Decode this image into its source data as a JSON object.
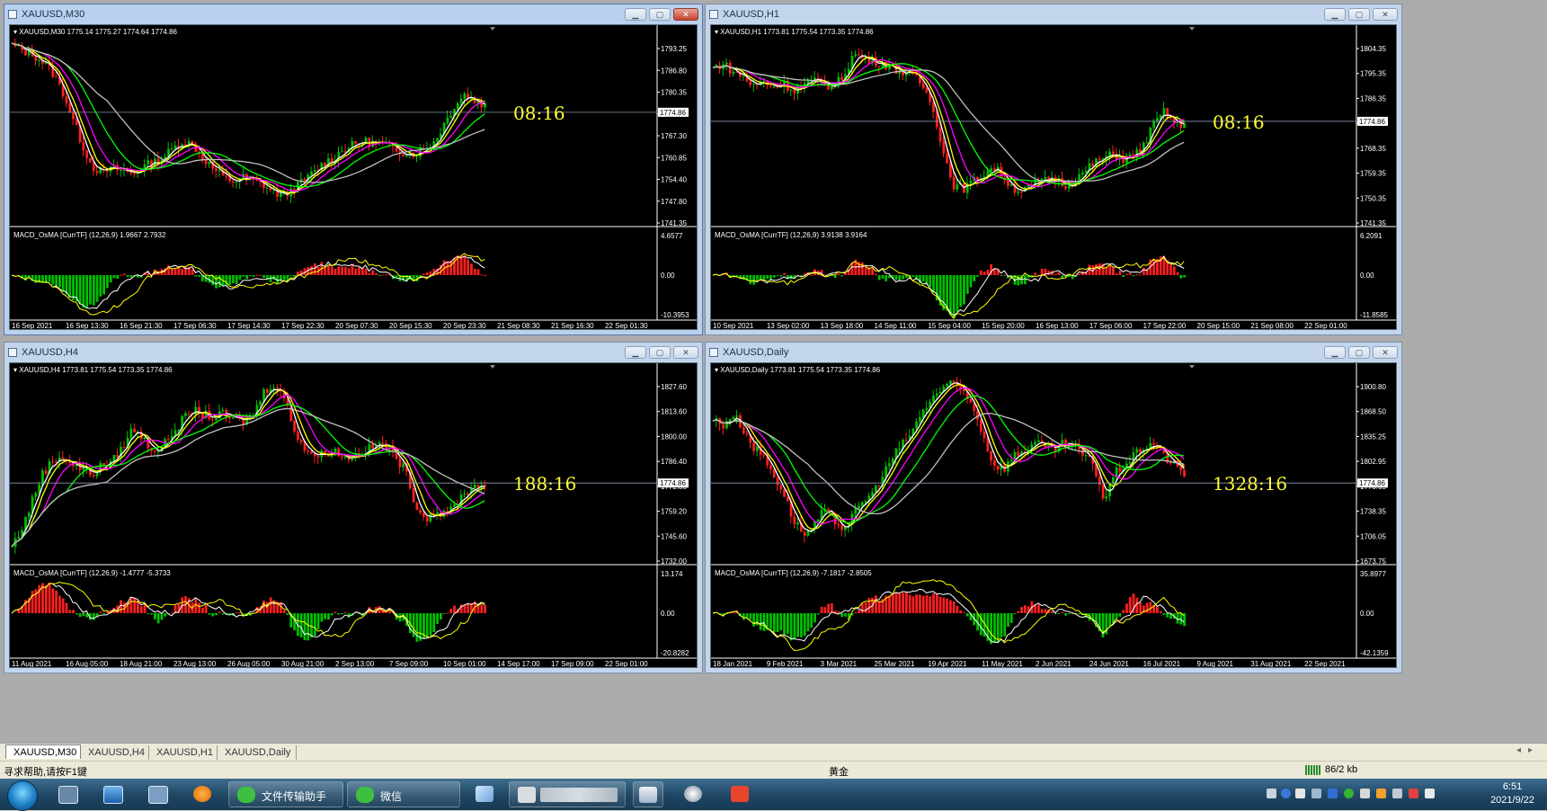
{
  "charts": [
    {
      "title": "XAUUSD,M30",
      "info": "XAUUSD,M30  1775.14 1775.27 1774.64 1774.86",
      "price_labels": [
        "1793.25",
        "1786.80",
        "1780.35",
        "1773.90",
        "1767.30",
        "1760.85",
        "1754.40",
        "1747.80",
        "1741.35"
      ],
      "current_price": "1774.86",
      "current_level": 0.42,
      "timer": "08:16",
      "ind_info": "MACD_OsMA [CurrTF] (12,26,9) 1.9667 2.7932",
      "ind_labels": [
        "4.6577",
        "0.00",
        "-10.3953"
      ],
      "time_labels": [
        "16 Sep 2021",
        "16 Sep 13:30",
        "16 Sep 21:30",
        "17 Sep 06:30",
        "17 Sep 14:30",
        "17 Sep 22:30",
        "20 Sep 07:30",
        "20 Sep 15:30",
        "20 Sep 23:30",
        "21 Sep 08:30",
        "21 Sep 16:30",
        "22 Sep 01:30"
      ],
      "active": true,
      "series": [
        0.95,
        0.92,
        0.9,
        0.86,
        0.8,
        0.7,
        0.55,
        0.4,
        0.28,
        0.25,
        0.27,
        0.26,
        0.24,
        0.28,
        0.3,
        0.33,
        0.38,
        0.42,
        0.4,
        0.33,
        0.27,
        0.22,
        0.2,
        0.22,
        0.2,
        0.18,
        0.14,
        0.12,
        0.16,
        0.2,
        0.25,
        0.3,
        0.33,
        0.38,
        0.4,
        0.42,
        0.41,
        0.4,
        0.38,
        0.36,
        0.35,
        0.38,
        0.42,
        0.52,
        0.62,
        0.68,
        0.64,
        0.62
      ]
    },
    {
      "title": "XAUUSD,H1",
      "info": "XAUUSD,H1  1773.81 1775.54 1773.35 1774.86",
      "price_labels": [
        "1804.35",
        "1795.35",
        "1786.35",
        "1777.35",
        "1768.35",
        "1759.35",
        "1750.35",
        "1741.35"
      ],
      "current_price": "1774.86",
      "current_level": 0.47,
      "timer": "08:16",
      "ind_info": "MACD_OsMA [CurrTF] (12,26,9) 3.9138 3.9164",
      "ind_labels": [
        "6.2091",
        "0.00",
        "-11.8585"
      ],
      "time_labels": [
        "10 Sep 2021",
        "13 Sep 02:00",
        "13 Sep 18:00",
        "14 Sep 11:00",
        "15 Sep 04:00",
        "15 Sep 20:00",
        "16 Sep 13:00",
        "17 Sep 06:00",
        "17 Sep 22:00",
        "20 Sep 15:00",
        "21 Sep 08:00",
        "22 Sep 01:00"
      ],
      "active": false,
      "series": [
        0.82,
        0.85,
        0.8,
        0.78,
        0.72,
        0.75,
        0.72,
        0.74,
        0.7,
        0.73,
        0.75,
        0.74,
        0.72,
        0.78,
        0.9,
        0.88,
        0.86,
        0.85,
        0.82,
        0.8,
        0.78,
        0.72,
        0.6,
        0.35,
        0.18,
        0.16,
        0.2,
        0.24,
        0.28,
        0.22,
        0.16,
        0.15,
        0.18,
        0.2,
        0.22,
        0.18,
        0.2,
        0.25,
        0.3,
        0.33,
        0.35,
        0.32,
        0.34,
        0.4,
        0.52,
        0.58,
        0.52,
        0.5
      ]
    },
    {
      "title": "XAUUSD,H4",
      "info": "XAUUSD,H4  1773.81 1775.54 1773.35 1774.86",
      "price_labels": [
        "1827.60",
        "1813.60",
        "1800.00",
        "1786.40",
        "1772.80",
        "1759.20",
        "1745.60",
        "1732.00"
      ],
      "current_price": "1774.86",
      "current_level": 0.6,
      "timer": "188:16",
      "ind_info": "MACD_OsMA [CurrTF] (12,26,9) -1.4777 -5.3733",
      "ind_labels": [
        "13.174",
        "0.00",
        "-20.8282"
      ],
      "time_labels": [
        "11 Aug 2021",
        "16 Aug 05:00",
        "18 Aug 21:00",
        "23 Aug 13:00",
        "26 Aug 05:00",
        "30 Aug 21:00",
        "2 Sep 13:00",
        "7 Sep 09:00",
        "10 Sep 01:00",
        "14 Sep 17:00",
        "17 Sep 09:00",
        "22 Sep 01:00"
      ],
      "active": false,
      "series": [
        0.05,
        0.15,
        0.3,
        0.45,
        0.52,
        0.55,
        0.5,
        0.48,
        0.45,
        0.5,
        0.52,
        0.6,
        0.7,
        0.65,
        0.58,
        0.6,
        0.68,
        0.75,
        0.8,
        0.78,
        0.76,
        0.78,
        0.75,
        0.74,
        0.78,
        0.9,
        0.95,
        0.88,
        0.7,
        0.6,
        0.55,
        0.56,
        0.58,
        0.54,
        0.55,
        0.58,
        0.6,
        0.62,
        0.55,
        0.48,
        0.3,
        0.2,
        0.25,
        0.22,
        0.28,
        0.35,
        0.38,
        0.4
      ]
    },
    {
      "title": "XAUUSD,Daily",
      "info": "XAUUSD,Daily  1773.81 1775.54 1773.35 1774.86",
      "price_labels": [
        "1900.80",
        "1868.50",
        "1835.25",
        "1802.95",
        "1770.65",
        "1738.35",
        "1706.05",
        "1673.75"
      ],
      "current_price": "1774.86",
      "current_level": 0.6,
      "timer": "1328:16",
      "ind_info": "MACD_OsMA [CurrTF] (12,26,9) -7.1817 -2.8505",
      "ind_labels": [
        "35.8977",
        "0.00",
        "-42.1359"
      ],
      "time_labels": [
        "18 Jan 2021",
        "9 Feb 2021",
        "3 Mar 2021",
        "25 Mar 2021",
        "19 Apr 2021",
        "11 May 2021",
        "2 Jun 2021",
        "24 Jun 2021",
        "16 Jul 2021",
        "9 Aug 2021",
        "31 Aug 2021",
        "22 Sep 2021"
      ],
      "active": false,
      "series": [
        0.75,
        0.72,
        0.78,
        0.7,
        0.6,
        0.55,
        0.45,
        0.35,
        0.2,
        0.12,
        0.15,
        0.25,
        0.2,
        0.15,
        0.22,
        0.3,
        0.35,
        0.45,
        0.55,
        0.62,
        0.7,
        0.8,
        0.88,
        0.92,
        0.95,
        0.9,
        0.82,
        0.65,
        0.5,
        0.48,
        0.55,
        0.58,
        0.62,
        0.6,
        0.58,
        0.62,
        0.6,
        0.55,
        0.5,
        0.3,
        0.45,
        0.5,
        0.55,
        0.6,
        0.62,
        0.55,
        0.5,
        0.45
      ]
    }
  ],
  "tabs": [
    "XAUUSD,M30",
    "XAUUSD,H4",
    "XAUUSD,H1",
    "XAUUSD,Daily"
  ],
  "status": {
    "help": "寻求帮助,请按F1键",
    "profile": "黄金",
    "traffic": "86/2 kb"
  },
  "taskbar": {
    "app1": "文件传输助手",
    "app2": "微信",
    "time": "6:51",
    "date": "2021/9/22"
  },
  "colors": {
    "candle_up": "#00c000",
    "candle_down": "#ff2020",
    "ma_fast": "#ffffff",
    "ma_yellow": "#ffff00",
    "ma_magenta": "#ff00ff",
    "ma_green": "#00ff00",
    "ma_slow": "#c0c0c0",
    "timer": "#ffff33"
  }
}
